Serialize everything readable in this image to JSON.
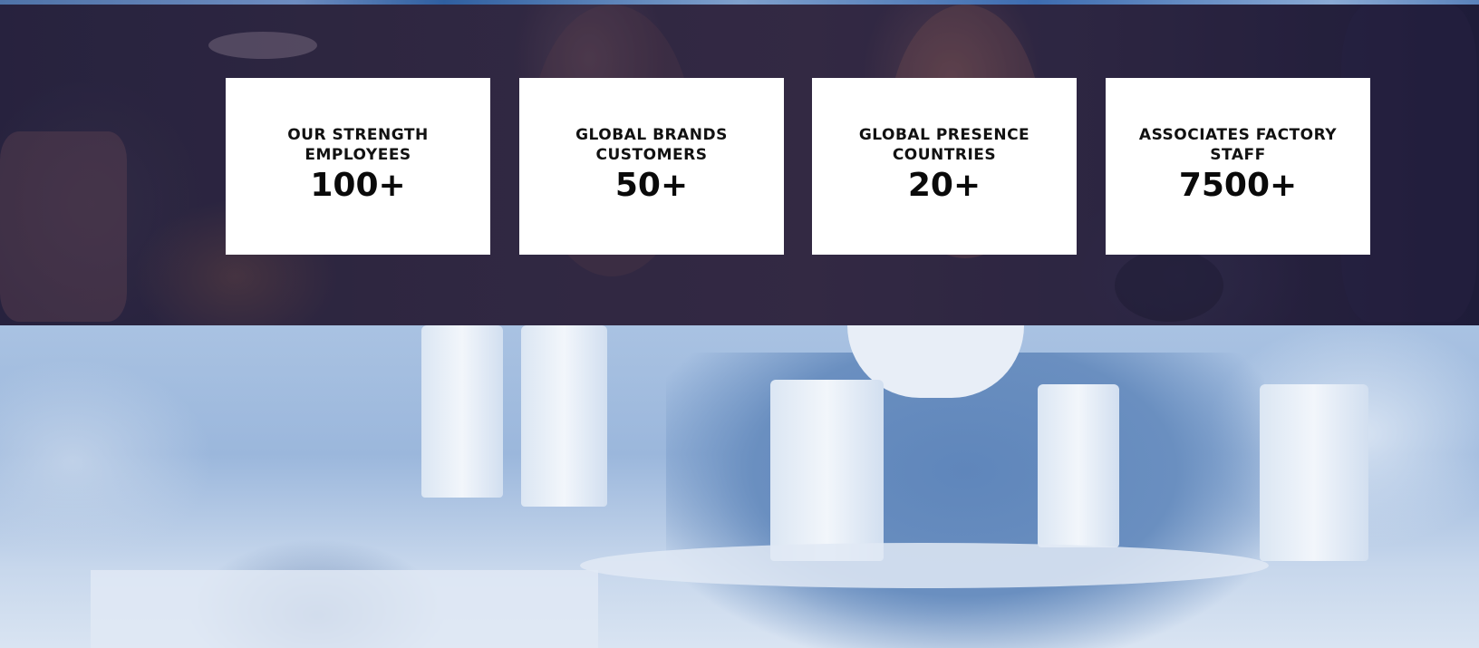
{
  "stats": [
    {
      "label": "OUR STRENGTH\nEMPLOYEES",
      "value": "100+"
    },
    {
      "label": "GLOBAL BRANDS\nCUSTOMERS",
      "value": "50+"
    },
    {
      "label": "GLOBAL PRESENCE\nCOUNTRIES",
      "value": "20+"
    },
    {
      "label": "ASSOCIATES FACTORY\nSTAFF",
      "value": "7500+"
    }
  ],
  "colors": {
    "card_background": "#ffffff",
    "stats_overlay": "#2a2545",
    "factory_tint": "#9bb7dc",
    "text": "#111111"
  }
}
